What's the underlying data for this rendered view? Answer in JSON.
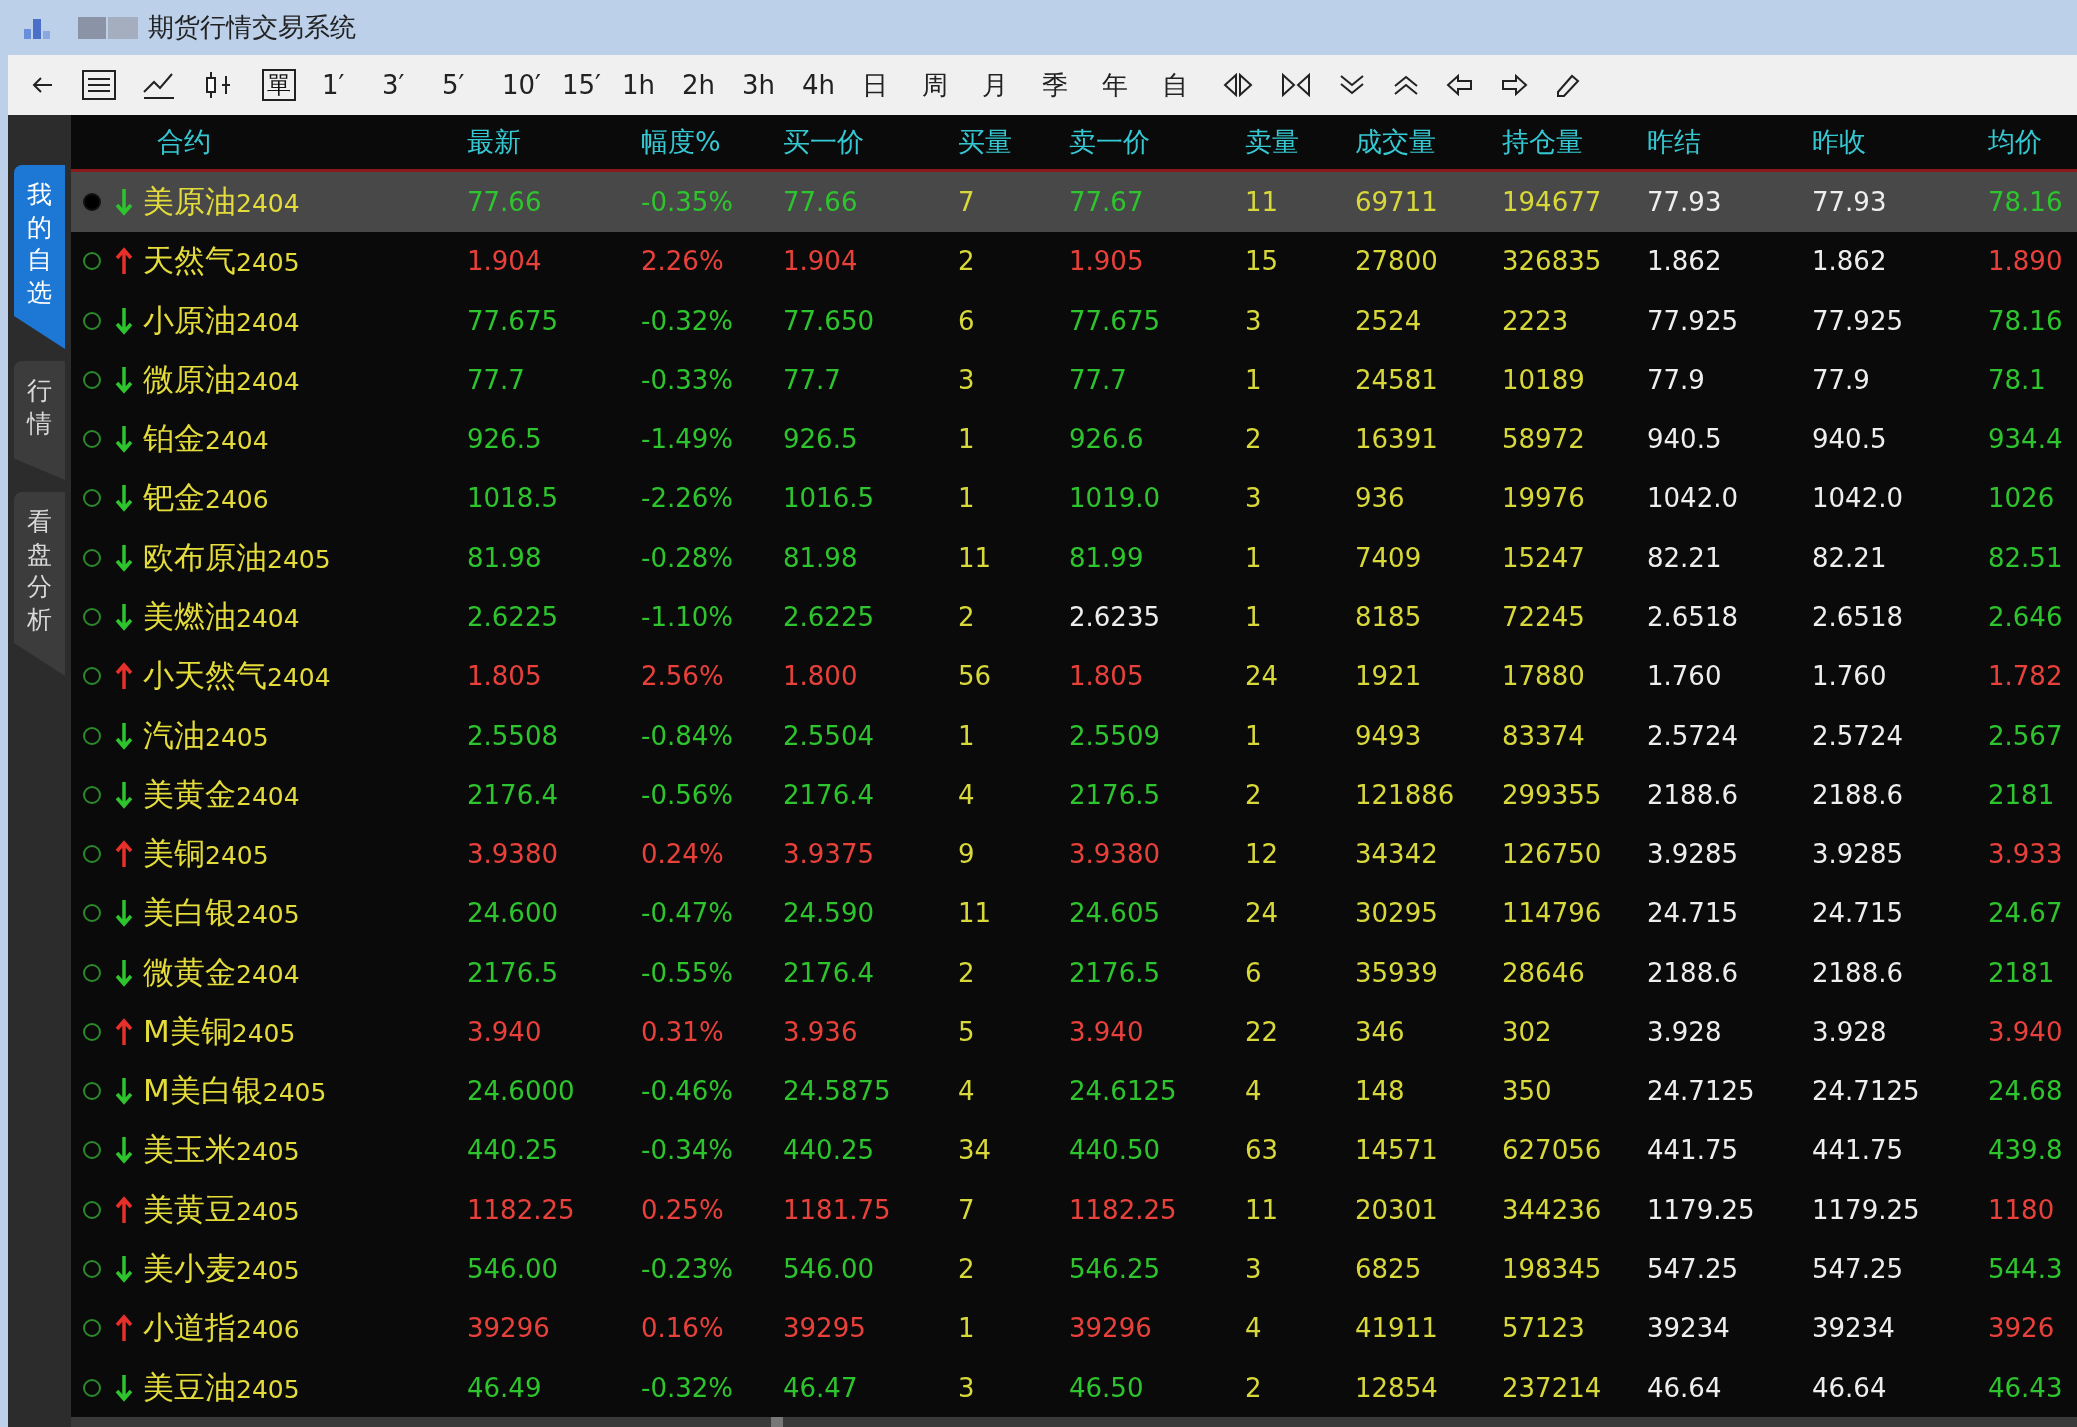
{
  "window": {
    "title": "期货行情交易系统"
  },
  "toolbar": {
    "box_label": "單",
    "periods": [
      "1′",
      "3′",
      "5′",
      "10′",
      "15′",
      "1h",
      "2h",
      "3h",
      "4h",
      "日",
      "周",
      "月",
      "季",
      "年",
      "自"
    ]
  },
  "side_tabs": [
    {
      "label": "我的自选",
      "selected": true
    },
    {
      "label": "行情",
      "selected": false
    },
    {
      "label": "看盘分析",
      "selected": false
    }
  ],
  "table": {
    "name_header": "合约",
    "columns": [
      {
        "label": "最新",
        "kind": "price"
      },
      {
        "label": "幅度%",
        "kind": "price"
      },
      {
        "label": "买一价",
        "kind": "price"
      },
      {
        "label": "买量",
        "kind": "volume"
      },
      {
        "label": "卖一价",
        "kind": "ask"
      },
      {
        "label": "卖量",
        "kind": "volume"
      },
      {
        "label": "成交量",
        "kind": "volume"
      },
      {
        "label": "持仓量",
        "kind": "volume"
      },
      {
        "label": "昨结",
        "kind": "ref"
      },
      {
        "label": "昨收",
        "kind": "ref"
      },
      {
        "label": "均价",
        "kind": "price"
      }
    ],
    "rows": [
      {
        "name": "美原油",
        "code": "2404",
        "rising": false,
        "ask_flat": false,
        "selected": true,
        "cells": [
          "77.66",
          "-0.35%",
          "77.66",
          "7",
          "77.67",
          "11",
          "69711",
          "194677",
          "77.93",
          "77.93",
          "78.16"
        ]
      },
      {
        "name": "天然气",
        "code": "2405",
        "rising": true,
        "ask_flat": false,
        "selected": false,
        "cells": [
          "1.904",
          "2.26%",
          "1.904",
          "2",
          "1.905",
          "15",
          "27800",
          "326835",
          "1.862",
          "1.862",
          "1.890"
        ]
      },
      {
        "name": "小原油",
        "code": "2404",
        "rising": false,
        "ask_flat": false,
        "selected": false,
        "cells": [
          "77.675",
          "-0.32%",
          "77.650",
          "6",
          "77.675",
          "3",
          "2524",
          "2223",
          "77.925",
          "77.925",
          "78.16"
        ]
      },
      {
        "name": "微原油",
        "code": "2404",
        "rising": false,
        "ask_flat": false,
        "selected": false,
        "cells": [
          "77.7",
          "-0.33%",
          "77.7",
          "3",
          "77.7",
          "1",
          "24581",
          "10189",
          "77.9",
          "77.9",
          "78.1"
        ]
      },
      {
        "name": "铂金",
        "code": "2404",
        "rising": false,
        "ask_flat": false,
        "selected": false,
        "cells": [
          "926.5",
          "-1.49%",
          "926.5",
          "1",
          "926.6",
          "2",
          "16391",
          "58972",
          "940.5",
          "940.5",
          "934.4"
        ]
      },
      {
        "name": "钯金",
        "code": "2406",
        "rising": false,
        "ask_flat": false,
        "selected": false,
        "cells": [
          "1018.5",
          "-2.26%",
          "1016.5",
          "1",
          "1019.0",
          "3",
          "936",
          "19976",
          "1042.0",
          "1042.0",
          "1026"
        ]
      },
      {
        "name": "欧布原油",
        "code": "2405",
        "rising": false,
        "ask_flat": false,
        "selected": false,
        "cells": [
          "81.98",
          "-0.28%",
          "81.98",
          "11",
          "81.99",
          "1",
          "7409",
          "15247",
          "82.21",
          "82.21",
          "82.51"
        ]
      },
      {
        "name": "美燃油",
        "code": "2404",
        "rising": false,
        "ask_flat": true,
        "selected": false,
        "cells": [
          "2.6225",
          "-1.10%",
          "2.6225",
          "2",
          "2.6235",
          "1",
          "8185",
          "72245",
          "2.6518",
          "2.6518",
          "2.646"
        ]
      },
      {
        "name": "小天然气",
        "code": "2404",
        "rising": true,
        "ask_flat": false,
        "selected": false,
        "cells": [
          "1.805",
          "2.56%",
          "1.800",
          "56",
          "1.805",
          "24",
          "1921",
          "17880",
          "1.760",
          "1.760",
          "1.782"
        ]
      },
      {
        "name": "汽油",
        "code": "2405",
        "rising": false,
        "ask_flat": false,
        "selected": false,
        "cells": [
          "2.5508",
          "-0.84%",
          "2.5504",
          "1",
          "2.5509",
          "1",
          "9493",
          "83374",
          "2.5724",
          "2.5724",
          "2.567"
        ]
      },
      {
        "name": "美黄金",
        "code": "2404",
        "rising": false,
        "ask_flat": false,
        "selected": false,
        "cells": [
          "2176.4",
          "-0.56%",
          "2176.4",
          "4",
          "2176.5",
          "2",
          "121886",
          "299355",
          "2188.6",
          "2188.6",
          "2181"
        ]
      },
      {
        "name": "美铜",
        "code": "2405",
        "rising": true,
        "ask_flat": false,
        "selected": false,
        "cells": [
          "3.9380",
          "0.24%",
          "3.9375",
          "9",
          "3.9380",
          "12",
          "34342",
          "126750",
          "3.9285",
          "3.9285",
          "3.933"
        ]
      },
      {
        "name": "美白银",
        "code": "2405",
        "rising": false,
        "ask_flat": false,
        "selected": false,
        "cells": [
          "24.600",
          "-0.47%",
          "24.590",
          "11",
          "24.605",
          "24",
          "30295",
          "114796",
          "24.715",
          "24.715",
          "24.67"
        ]
      },
      {
        "name": "微黄金",
        "code": "2404",
        "rising": false,
        "ask_flat": false,
        "selected": false,
        "cells": [
          "2176.5",
          "-0.55%",
          "2176.4",
          "2",
          "2176.5",
          "6",
          "35939",
          "28646",
          "2188.6",
          "2188.6",
          "2181"
        ]
      },
      {
        "name": "M美铜",
        "code": "2405",
        "rising": true,
        "ask_flat": false,
        "selected": false,
        "cells": [
          "3.940",
          "0.31%",
          "3.936",
          "5",
          "3.940",
          "22",
          "346",
          "302",
          "3.928",
          "3.928",
          "3.940"
        ]
      },
      {
        "name": "M美白银",
        "code": "2405",
        "rising": false,
        "ask_flat": false,
        "selected": false,
        "cells": [
          "24.6000",
          "-0.46%",
          "24.5875",
          "4",
          "24.6125",
          "4",
          "148",
          "350",
          "24.7125",
          "24.7125",
          "24.68"
        ]
      },
      {
        "name": "美玉米",
        "code": "2405",
        "rising": false,
        "ask_flat": false,
        "selected": false,
        "cells": [
          "440.25",
          "-0.34%",
          "440.25",
          "34",
          "440.50",
          "63",
          "14571",
          "627056",
          "441.75",
          "441.75",
          "439.8"
        ]
      },
      {
        "name": "美黄豆",
        "code": "2405",
        "rising": true,
        "ask_flat": false,
        "selected": false,
        "cells": [
          "1182.25",
          "0.25%",
          "1181.75",
          "7",
          "1182.25",
          "11",
          "20301",
          "344236",
          "1179.25",
          "1179.25",
          "1180"
        ]
      },
      {
        "name": "美小麦",
        "code": "2405",
        "rising": false,
        "ask_flat": false,
        "selected": false,
        "cells": [
          "546.00",
          "-0.23%",
          "546.00",
          "2",
          "546.25",
          "3",
          "6825",
          "198345",
          "547.25",
          "547.25",
          "544.3"
        ]
      },
      {
        "name": "小道指",
        "code": "2406",
        "rising": true,
        "ask_flat": false,
        "selected": false,
        "cells": [
          "39296",
          "0.16%",
          "39295",
          "1",
          "39296",
          "4",
          "41911",
          "57123",
          "39234",
          "39234",
          "3926"
        ]
      },
      {
        "name": "美豆油",
        "code": "2405",
        "rising": false,
        "ask_flat": false,
        "selected": false,
        "cells": [
          "46.49",
          "-0.32%",
          "46.47",
          "3",
          "46.50",
          "2",
          "12854",
          "237214",
          "46.64",
          "46.64",
          "46.43"
        ]
      }
    ]
  }
}
